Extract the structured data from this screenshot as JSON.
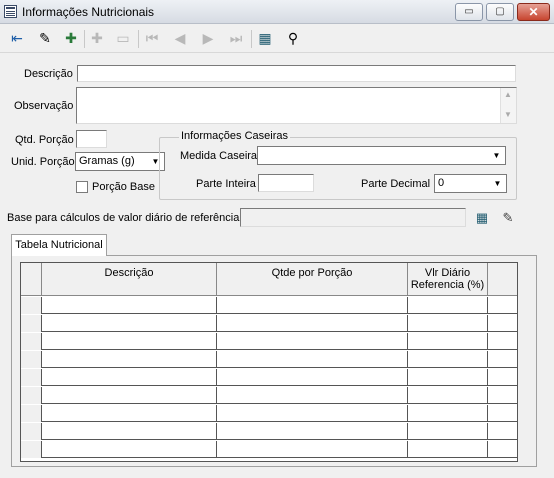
{
  "window": {
    "title": "Informações Nutricionais",
    "min_glyph": "▭",
    "max_glyph": "▢",
    "close_glyph": "✕"
  },
  "toolbar": {
    "items": [
      {
        "name": "exit-icon",
        "glyph": "⇤",
        "enabled": true
      },
      {
        "name": "edit-pencil-icon",
        "glyph": "✎",
        "enabled": true
      },
      {
        "name": "add-record-icon",
        "glyph": "✚",
        "enabled": true
      },
      {
        "name": "add-disabled-icon",
        "glyph": "✚",
        "enabled": false
      },
      {
        "name": "remove-disabled-icon",
        "glyph": "▭",
        "enabled": false
      },
      {
        "name": "first-record-icon",
        "glyph": "⏮",
        "enabled": false
      },
      {
        "name": "previous-record-icon",
        "glyph": "◀",
        "enabled": false
      },
      {
        "name": "next-record-icon",
        "glyph": "▶",
        "enabled": false
      },
      {
        "name": "last-record-icon",
        "glyph": "⏭",
        "enabled": false
      },
      {
        "name": "grid-table-icon",
        "glyph": "▦",
        "enabled": true
      },
      {
        "name": "binoculars-icon",
        "glyph": "⚲",
        "enabled": true
      }
    ]
  },
  "form": {
    "descricao_label": "Descrição",
    "descricao_value": "",
    "observacao_label": "Observação",
    "observacao_value": "",
    "qtd_porcao_label": "Qtd. Porção",
    "qtd_porcao_value": "",
    "unid_porcao_label": "Unid. Porção",
    "unid_porcao_value": "Gramas (g)",
    "porcao_base_label": "Porção Base",
    "porcao_base_checked": false,
    "caseiras_title": "Informações Caseiras",
    "medida_caseira_label": "Medida Caseira",
    "medida_caseira_value": "",
    "parte_inteira_label": "Parte Inteira",
    "parte_inteira_value": "",
    "parte_decimal_label": "Parte Decimal",
    "parte_decimal_value": "0",
    "base_calculo_label": "Base para cálculos de valor diário de referência",
    "base_calculo_value": ""
  },
  "tabs": [
    {
      "label": "Tabela Nutricional",
      "active": true
    }
  ],
  "table": {
    "columns": [
      {
        "label": "Descrição"
      },
      {
        "label": "Qtde por Porção"
      },
      {
        "label": "Vlr Diário\nReferencia (%)"
      }
    ],
    "rows": [
      [
        "",
        "",
        ""
      ],
      [
        "",
        "",
        ""
      ],
      [
        "",
        "",
        ""
      ],
      [
        "",
        "",
        ""
      ],
      [
        "",
        "",
        ""
      ],
      [
        "",
        "",
        ""
      ],
      [
        "",
        "",
        ""
      ],
      [
        "",
        "",
        ""
      ],
      [
        "",
        "",
        ""
      ]
    ]
  },
  "colors": {
    "window_bg": "#f0f0f0",
    "grid_line": "#555555",
    "disabled": "#b8b8b8"
  }
}
